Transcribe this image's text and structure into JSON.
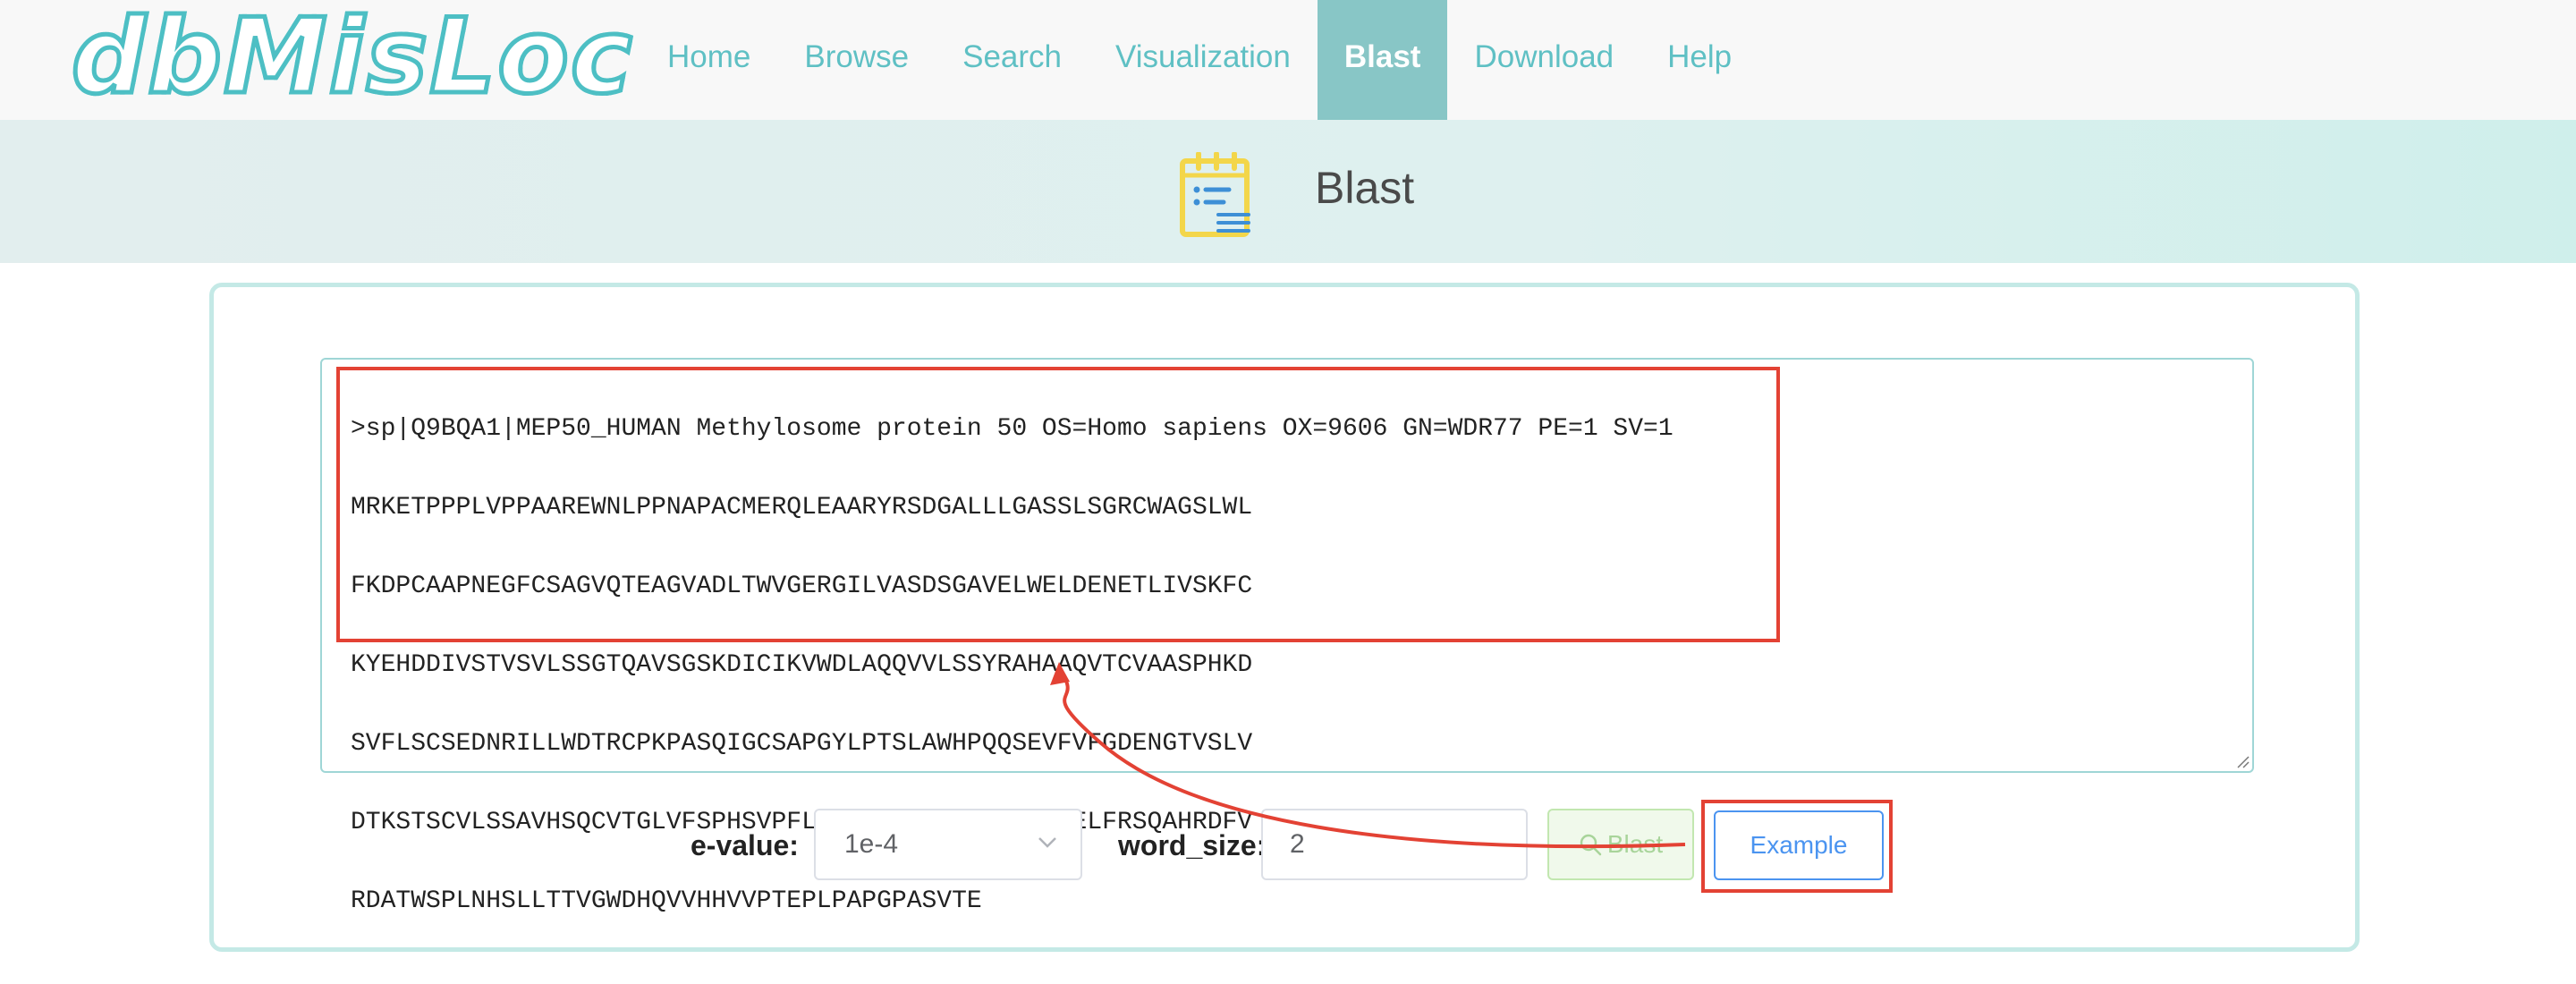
{
  "logo": {
    "text": "dbMisLoc"
  },
  "nav": {
    "items": [
      {
        "label": "Home",
        "active": false
      },
      {
        "label": "Browse",
        "active": false
      },
      {
        "label": "Search",
        "active": false
      },
      {
        "label": "Visualization",
        "active": false
      },
      {
        "label": "Blast",
        "active": true
      },
      {
        "label": "Download",
        "active": false
      },
      {
        "label": "Help",
        "active": false
      }
    ]
  },
  "banner": {
    "title": "Blast",
    "icon": "clipboard-list-icon"
  },
  "sequence": {
    "lines": [
      ">sp|Q9BQA1|MEP50_HUMAN Methylosome protein 50 OS=Homo sapiens OX=9606 GN=WDR77 PE=1 SV=1",
      "MRKETPPPLVPPAAREWNLPPNAPACMERQLEAARYRSDGALLLGASSLSGRCWAGSLWL",
      "FKDPCAAPNEGFCSAGVQTEAGVADLTWVGERGILVASDSGAVELWELDENETLIVSKFC",
      "KYEHDDIVSTVSVLSSGTQAVSGSKDICIKVWDLAQQVVLSSYRAHAAQVTCVAASPHKD",
      "SVFLSCSEDNRILLWDTRCPKPASQIGCSAPGYLPTSLAWHPQQSEVFVFGDENGTVSLV",
      "DTKSTSCVLSSAVHSQCVTGLVFSPHSVPFLASLSEDCSLAVLDSSLSELFRSQAHRDFV",
      "RDATWSPLNHSLLTTVGWDHQVVHHVVPTEPLPAPGPASVTE"
    ]
  },
  "controls": {
    "evalue_label": "e-value:",
    "evalue_value": "1e-4",
    "wordsize_label": "word_size:",
    "wordsize_value": "2",
    "blast_label": "Blast",
    "example_label": "Example"
  },
  "colors": {
    "accent": "#5fc0c4",
    "nav_active_bg": "#88c6c6",
    "annotation_red": "#e34234",
    "example_blue": "#4b94f0",
    "blast_green": "#a8d49a"
  }
}
